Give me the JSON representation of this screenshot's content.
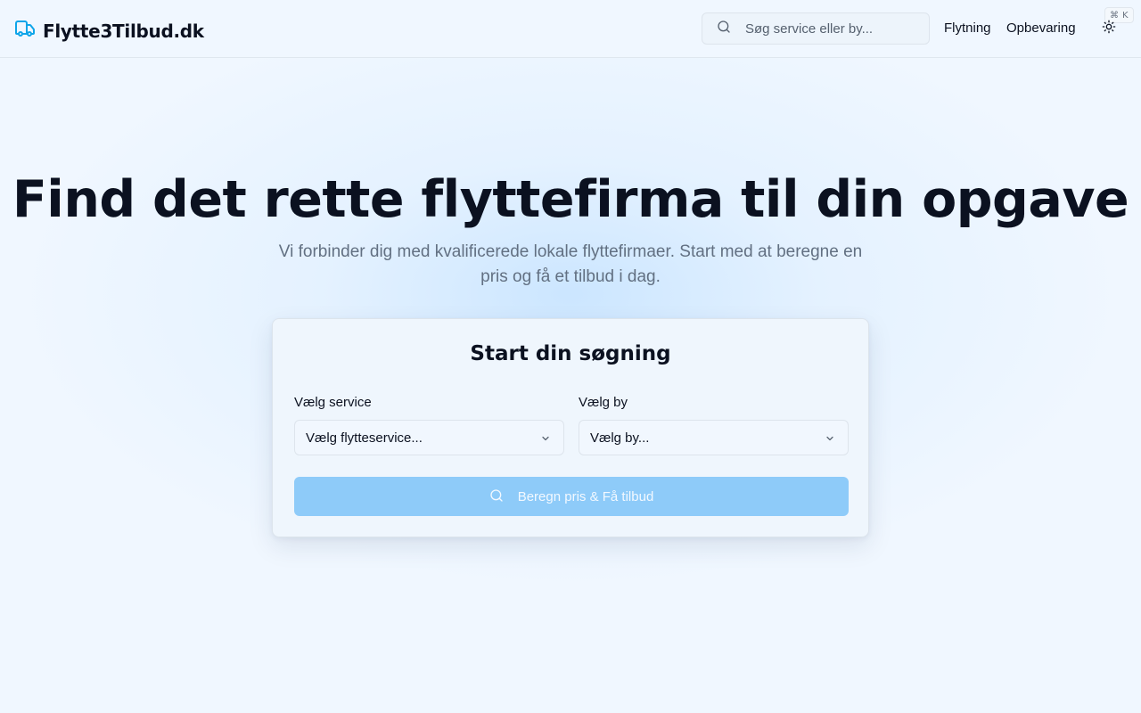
{
  "header": {
    "logo_text": "Flytte3Tilbud.dk",
    "search_placeholder": "Søg service eller by...",
    "shortcut_symbol": "⌘",
    "shortcut_key": "K",
    "nav": [
      {
        "label": "Flytning"
      },
      {
        "label": "Opbevaring"
      }
    ]
  },
  "hero": {
    "title": "Find det rette flyttefirma til din opgave",
    "subtitle": "Vi forbinder dig med kvalificerede lokale flyttefirmaer. Start med at beregne en pris og få et tilbud i dag."
  },
  "search_card": {
    "title": "Start din søgning",
    "service_label": "Vælg service",
    "service_value": "Vælg flytteservice...",
    "city_label": "Vælg by",
    "city_value": "Vælg by...",
    "submit_label": "Beregn pris & Få tilbud"
  },
  "colors": {
    "brand": "#0ea5e9",
    "background": "#f0f7ff",
    "button": "#8ecbf9"
  },
  "icons": {
    "logo": "truck-icon",
    "search": "search-icon",
    "theme": "sun-icon",
    "dropdown": "chevron-down-icon"
  }
}
